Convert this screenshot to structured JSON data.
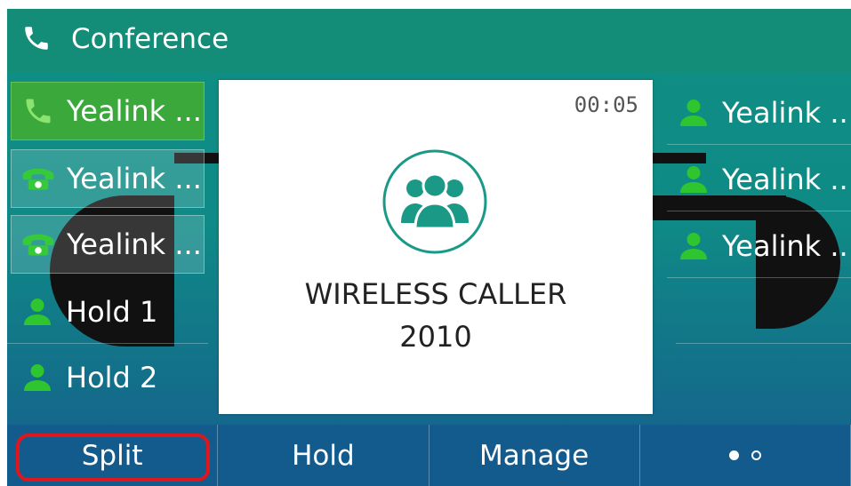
{
  "header": {
    "title": "Conference",
    "icon": "phone-handset-icon"
  },
  "left_list": [
    {
      "label": "Yealink ...",
      "icon": "phone-handset-icon",
      "state": "active"
    },
    {
      "label": "Yealink ...",
      "icon": "telephone-icon",
      "state": "boxed"
    },
    {
      "label": "Yealink ...",
      "icon": "telephone-icon",
      "state": "boxed"
    },
    {
      "label": "Hold 1",
      "icon": "contact-icon",
      "state": "plain"
    },
    {
      "label": "Hold 2",
      "icon": "contact-icon",
      "state": "plain"
    }
  ],
  "right_list": [
    {
      "label": "Yealink ...",
      "icon": "contact-icon"
    },
    {
      "label": "Yealink ...",
      "icon": "contact-icon"
    },
    {
      "label": "Yealink ...",
      "icon": "contact-icon"
    }
  ],
  "call": {
    "timer": "00:05",
    "name": "WIRELESS CALLER",
    "number": "2010",
    "icon": "conference-group-icon"
  },
  "softkeys": {
    "split": "Split",
    "hold": "Hold",
    "manage": "Manage",
    "more_icon": "page-dots-icon"
  },
  "colors": {
    "titlebar": "#138c78",
    "accent_green": "#3aa83b",
    "icon_green": "#2ec52e",
    "softkey_bar": "#135b8c",
    "highlight_red": "#e0161d",
    "teal_icon": "#1a9a86"
  }
}
